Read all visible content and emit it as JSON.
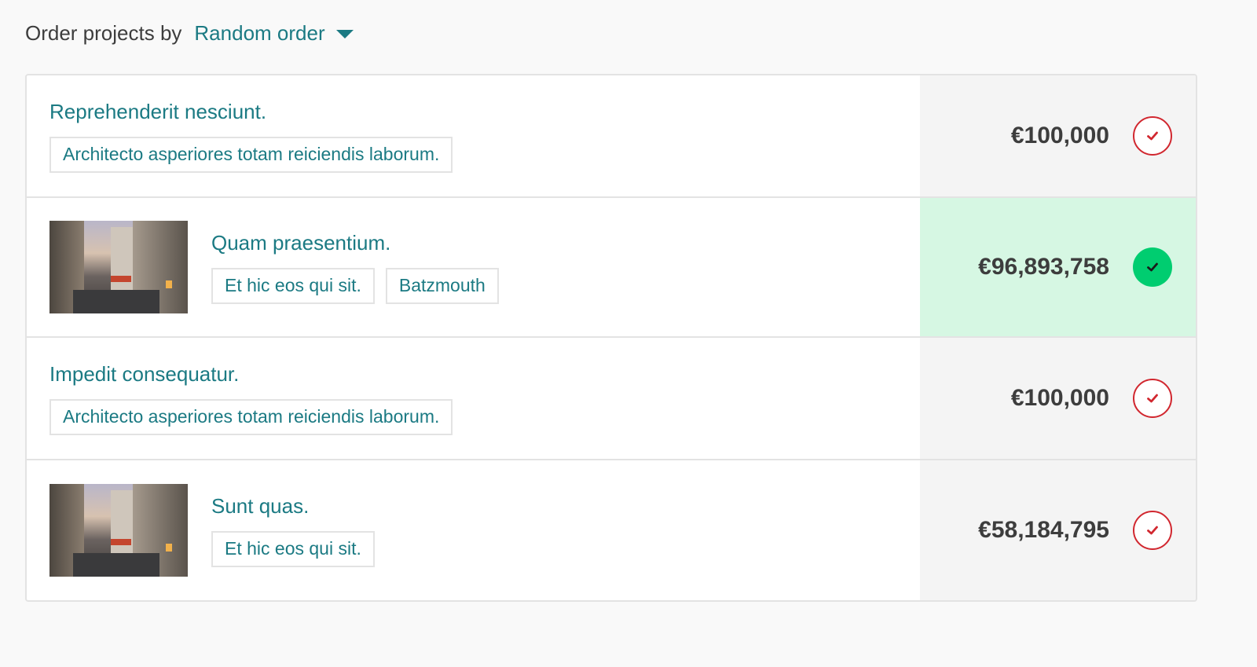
{
  "order": {
    "label": "Order projects by",
    "selected": "Random order"
  },
  "colors": {
    "accent": "#1b7a83",
    "selected_bg": "#d6f7e3",
    "selected_check": "#00cd70",
    "unselected_check": "#d1272f"
  },
  "projects": [
    {
      "title": "Reprehenderit nesciunt.",
      "tags": [
        "Architecto asperiores totam reiciendis laborum."
      ],
      "amount": "€100,000",
      "has_image": false,
      "selected": false
    },
    {
      "title": "Quam praesentium.",
      "tags": [
        "Et hic eos qui sit.",
        "Batzmouth"
      ],
      "amount": "€96,893,758",
      "has_image": true,
      "selected": true
    },
    {
      "title": "Impedit consequatur.",
      "tags": [
        "Architecto asperiores totam reiciendis laborum."
      ],
      "amount": "€100,000",
      "has_image": false,
      "selected": false
    },
    {
      "title": "Sunt quas.",
      "tags": [
        "Et hic eos qui sit."
      ],
      "amount": "€58,184,795",
      "has_image": true,
      "selected": false
    }
  ]
}
